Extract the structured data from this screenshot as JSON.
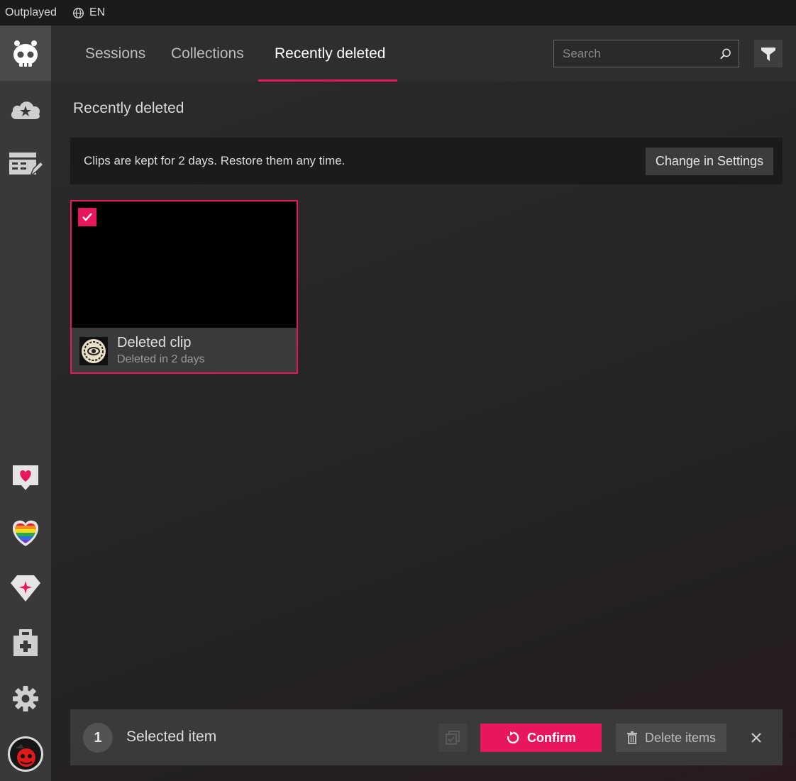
{
  "titlebar": {
    "app_name": "Outplayed",
    "language": "EN"
  },
  "sidebar": {
    "items": [
      {
        "name": "home",
        "icon": "skull-icon",
        "active": true
      },
      {
        "name": "cloud",
        "icon": "cloud-star-icon"
      },
      {
        "name": "editor",
        "icon": "clapperboard-edit-icon"
      },
      {
        "name": "feedback",
        "icon": "heart-chat-icon"
      },
      {
        "name": "pride",
        "icon": "rainbow-heart-icon"
      },
      {
        "name": "premium",
        "icon": "gem-icon"
      },
      {
        "name": "toolbox",
        "icon": "medkit-icon"
      },
      {
        "name": "settings",
        "icon": "gear-icon"
      },
      {
        "name": "profile",
        "icon": "avatar"
      }
    ]
  },
  "tabs": [
    {
      "label": "Sessions"
    },
    {
      "label": "Collections"
    },
    {
      "label": "Recently deleted",
      "active": true
    }
  ],
  "search": {
    "placeholder": "Search",
    "value": ""
  },
  "section_title": "Recently deleted",
  "info_bar": {
    "text": "Clips are kept for 2 days. Restore them any time.",
    "button_label": "Change in Settings"
  },
  "clip": {
    "title": "Deleted clip",
    "subtitle": "Deleted in 2 days",
    "selected": true
  },
  "selection_bar": {
    "count": "1",
    "label": "Selected item",
    "confirm_label": "Confirm",
    "delete_label": "Delete items"
  },
  "colors": {
    "accent": "#e8175d",
    "sidebar": "#39393b",
    "titlebar": "#1b1b1c"
  }
}
